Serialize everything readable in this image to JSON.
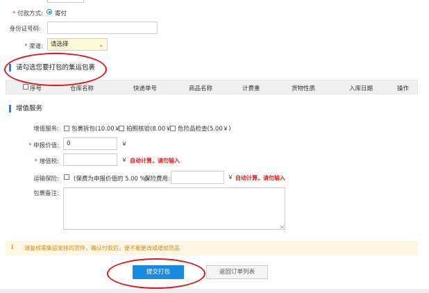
{
  "payment": {
    "label": "付款方式:",
    "option": "寄付"
  },
  "id_number": {
    "label": "身份证号码:",
    "value": ""
  },
  "channel": {
    "label": "渠道:",
    "selected": "请选择"
  },
  "parcels_section": {
    "title": "请勾选您要打包的集运包裹"
  },
  "table": {
    "headers": [
      "序号",
      "仓库名称",
      "快递单号",
      "商品名称",
      "计费重",
      "货物性质",
      "入库日期",
      "操作"
    ]
  },
  "value_added_section": {
    "title": "增值服务"
  },
  "services": {
    "label": "增值服务:",
    "options": [
      "包裹拆包(10.00￥)",
      "拍照核验(8.00￥)",
      "危险品检查(5.00￥)"
    ]
  },
  "declared_value": {
    "label": "申报价值:",
    "value": "0",
    "unit": "￥"
  },
  "vat": {
    "label": "增值税:",
    "value": "",
    "unit": "￥",
    "hint": "自动计算，请勿输入"
  },
  "insurance": {
    "label": "运输保险:",
    "desc": "(保费为申报价值的 5.00 %)",
    "fee_label": "保险费用:",
    "unit": "￥",
    "hint": "自动计算，请勿输入"
  },
  "remark": {
    "label": "包裹备注:",
    "value": ""
  },
  "notice": {
    "text": "请复核需集运安排的货件，确认付款后，便不能更改或增加货品"
  },
  "buttons": {
    "submit": "提交打包",
    "back": "返回订单列表"
  },
  "colors": {
    "accent": "#1a8ae0",
    "annotation": "#e01515",
    "notice_bg": "#fdf6e3"
  }
}
